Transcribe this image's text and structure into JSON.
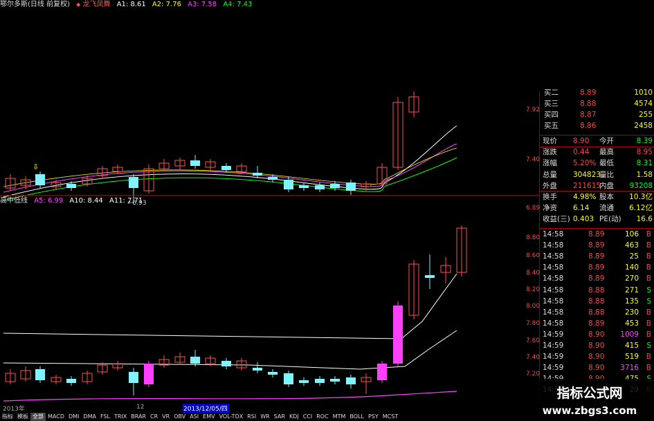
{
  "legend_top": {
    "title": "鄂尔多斯(日线 前复权)",
    "indicator": "龙飞凤舞",
    "items": [
      {
        "label": "A1: 8.61",
        "color": "#ffffff"
      },
      {
        "label": "A2: 7.76",
        "color": "#ffff00"
      },
      {
        "label": "A3: 7.58",
        "color": "#ff40ff"
      },
      {
        "label": "A4: 7.43",
        "color": "#00ff00"
      }
    ]
  },
  "legend_bottom": {
    "title": "高中低线",
    "items": [
      {
        "label": "A5: 6.99",
        "color": "#ff40ff"
      },
      {
        "label": "A10: 8.44",
        "color": "#ffffff"
      },
      {
        "label": "A11: 7.71",
        "color": "#ffffff"
      }
    ]
  },
  "axis_top": [
    "7.92",
    "7.40",
    "6.89"
  ],
  "axis_bottom": [
    "8.80",
    "8.60",
    "8.40",
    "8.20",
    "8.00",
    "7.80",
    "7.60",
    "7.40",
    "7.20"
  ],
  "low_marker": "6.93",
  "quote": {
    "bids": [
      {
        "label": "买二",
        "price": "8.89",
        "vol": "1010"
      },
      {
        "label": "买三",
        "price": "8.88",
        "vol": "4574"
      },
      {
        "label": "买四",
        "price": "8.87",
        "vol": "255"
      },
      {
        "label": "买五",
        "price": "8.86",
        "vol": "2458"
      }
    ],
    "stats": [
      {
        "k1": "现价",
        "v1": "8.90",
        "k2": "今开",
        "v2": "8.39"
      },
      {
        "k1": "涨跌",
        "v1": "0.44",
        "k2": "最高",
        "v2": "8.95"
      },
      {
        "k1": "涨幅",
        "v1": "5.20%",
        "k2": "最低",
        "v2": "8.31"
      },
      {
        "k1": "总量",
        "v1": "304823",
        "k2": "量比",
        "v2": "1.58"
      },
      {
        "k1": "外盘",
        "v1": "211615",
        "k2": "内盘",
        "v2": "93208"
      },
      {
        "k1": "换手",
        "v1": "4.98%",
        "k2": "股本",
        "v2": "10.3亿"
      },
      {
        "k1": "净资",
        "v1": "6.14",
        "k2": "流通",
        "v2": "6.12亿"
      },
      {
        "k1": "收益(三)",
        "v1": "0.403",
        "k2": "PE(动)",
        "v2": "16.6"
      }
    ]
  },
  "ticks": [
    {
      "time": "14:58",
      "price": "8.89",
      "vol": "106",
      "bs": "B"
    },
    {
      "time": "14:58",
      "price": "8.89",
      "vol": "463",
      "bs": "B"
    },
    {
      "time": "14:58",
      "price": "8.89",
      "vol": "25",
      "bs": "B"
    },
    {
      "time": "14:58",
      "price": "8.89",
      "vol": "140",
      "bs": "B"
    },
    {
      "time": "14:58",
      "price": "8.89",
      "vol": "270",
      "bs": "B"
    },
    {
      "time": "14:58",
      "price": "8.88",
      "vol": "271",
      "bs": "S"
    },
    {
      "time": "14:58",
      "price": "8.88",
      "vol": "135",
      "bs": "S"
    },
    {
      "time": "14:58",
      "price": "8.88",
      "vol": "230",
      "bs": "B"
    },
    {
      "time": "14:58",
      "price": "8.89",
      "vol": "453",
      "bs": "B"
    },
    {
      "time": "14:59",
      "price": "8.90",
      "vol": "1009",
      "bs": "B"
    },
    {
      "time": "14:59",
      "price": "8.90",
      "vol": "415",
      "bs": "S"
    },
    {
      "time": "14:59",
      "price": "8.90",
      "vol": "519",
      "bs": "B"
    },
    {
      "time": "14:59",
      "price": "8.90",
      "vol": "3716",
      "bs": "B"
    },
    {
      "time": "14:59",
      "price": "8.90",
      "vol": "475",
      "bs": "S"
    },
    {
      "time": "14:59",
      "price": "8.91",
      "vol": "29",
      "bs": "B"
    }
  ],
  "date_bar": {
    "year": "2013年",
    "month": "12",
    "cursor_date": "2013/12/05/四"
  },
  "tabs": [
    "指标",
    "模板",
    "全部",
    "MACD",
    "DMI",
    "DMA",
    "FSL",
    "TRIX",
    "BRAR",
    "CR",
    "VR",
    "OBV",
    "ASI",
    "EMV",
    "VOL-TDX",
    "RSI",
    "WR",
    "SAR",
    "KDJ",
    "CCI",
    "ROC",
    "MTM",
    "BOLL",
    "PSY",
    "MCST"
  ],
  "watermark": {
    "title": "指标公式网",
    "url": "www.zbgs3.com"
  }
}
